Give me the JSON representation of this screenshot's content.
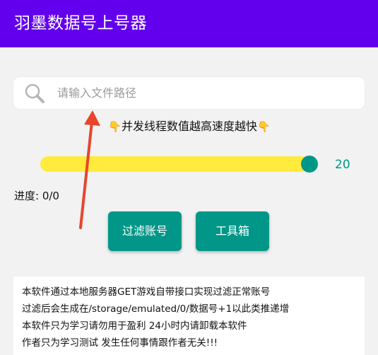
{
  "appbar": {
    "title": "羽墨数据号上号器"
  },
  "search": {
    "placeholder": "请输入文件路径",
    "value": ""
  },
  "hint": {
    "text": "并发线程数值越高速度越快",
    "hand_icon": "👇"
  },
  "slider": {
    "value": "20",
    "fraction": 0.95
  },
  "progress": {
    "text": "进度: 0/0"
  },
  "buttons": {
    "filter": "过滤账号",
    "tools": "工具箱"
  },
  "info": {
    "lines": [
      "本软件通过本地服务器GET游戏自带接口实现过滤正常账号",
      "过滤后会生成在/storage/emulated/0/数据号+1以此类推递增",
      "本软件只为学习请勿用于盈利 24小时内请卸载本软件",
      "作者只为学习测试 发生任何事情跟作者无关!!!"
    ]
  },
  "colors": {
    "appbar": "#6200ee",
    "accent": "#009688",
    "slider_track": "#ffeb3b",
    "annotation_arrow": "#e8452c"
  }
}
